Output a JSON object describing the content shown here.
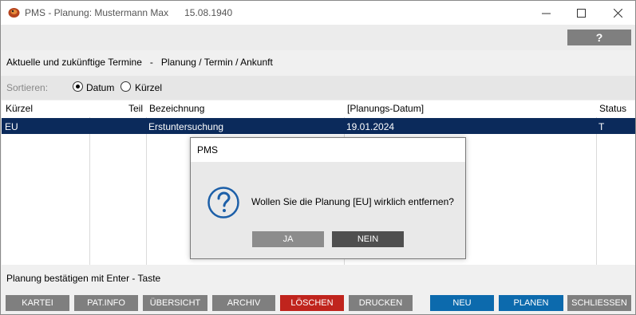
{
  "window": {
    "title": "PMS - Planung: Mustermann Max",
    "date": "15.08.1940",
    "help_label": "?"
  },
  "header": {
    "left": "Aktuelle und zukünftige Termine",
    "separator": "-",
    "right": "Planung / Termin / Ankunft"
  },
  "sort": {
    "label": "Sortieren:",
    "options": [
      {
        "label": "Datum",
        "checked": true
      },
      {
        "label": "Kürzel",
        "checked": false
      }
    ]
  },
  "table": {
    "columns": [
      "Kürzel",
      "Teil",
      "Bezeichnung",
      "[Planungs-Datum]",
      "Status"
    ],
    "rows": [
      {
        "kuerzel": "EU",
        "teil": "",
        "bezeichnung": "Erstuntersuchung",
        "datum": "19.01.2024",
        "status": "T"
      }
    ]
  },
  "status_line": "Planung bestätigen mit Enter - Taste",
  "buttons": {
    "kartei": "KARTEI",
    "patinfo": "PAT.INFO",
    "uebersicht": "ÜBERSICHT",
    "archiv": "ARCHIV",
    "loeschen": "LÖSCHEN",
    "drucken": "DRUCKEN",
    "neu": "NEU",
    "planen": "PLANEN",
    "schliessen": "SCHLIESSEN"
  },
  "dialog": {
    "title": "PMS",
    "message": "Wollen Sie die Planung [EU] wirklich entfernen?",
    "yes": "JA",
    "no": "NEIN"
  },
  "colors": {
    "selection": "#0b2a5b",
    "delete": "#c0241d",
    "primary": "#0c6aad",
    "neutral": "#7f7f7f"
  }
}
